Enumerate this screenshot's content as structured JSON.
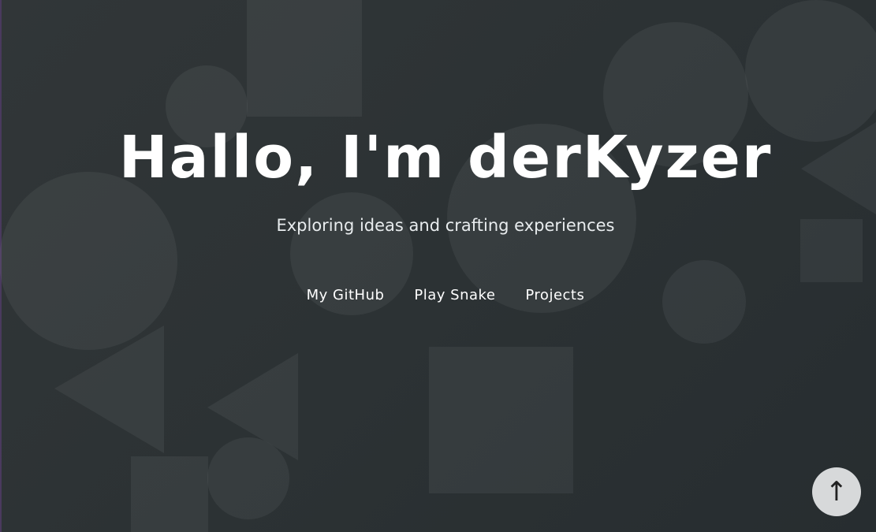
{
  "hero": {
    "title": "Hallo, I'm derKyzer",
    "subtitle": "Exploring ideas and crafting experiences"
  },
  "nav": {
    "items": [
      {
        "label": "My GitHub"
      },
      {
        "label": "Play Snake"
      },
      {
        "label": "Projects"
      }
    ]
  },
  "scroll_top": {
    "glyph": "↑",
    "icon": "arrow-up-icon"
  },
  "colors": {
    "background": "#2c3234",
    "shape": "#ffffff",
    "text": "#ffffff",
    "scroll_button": "#d7d9da"
  }
}
